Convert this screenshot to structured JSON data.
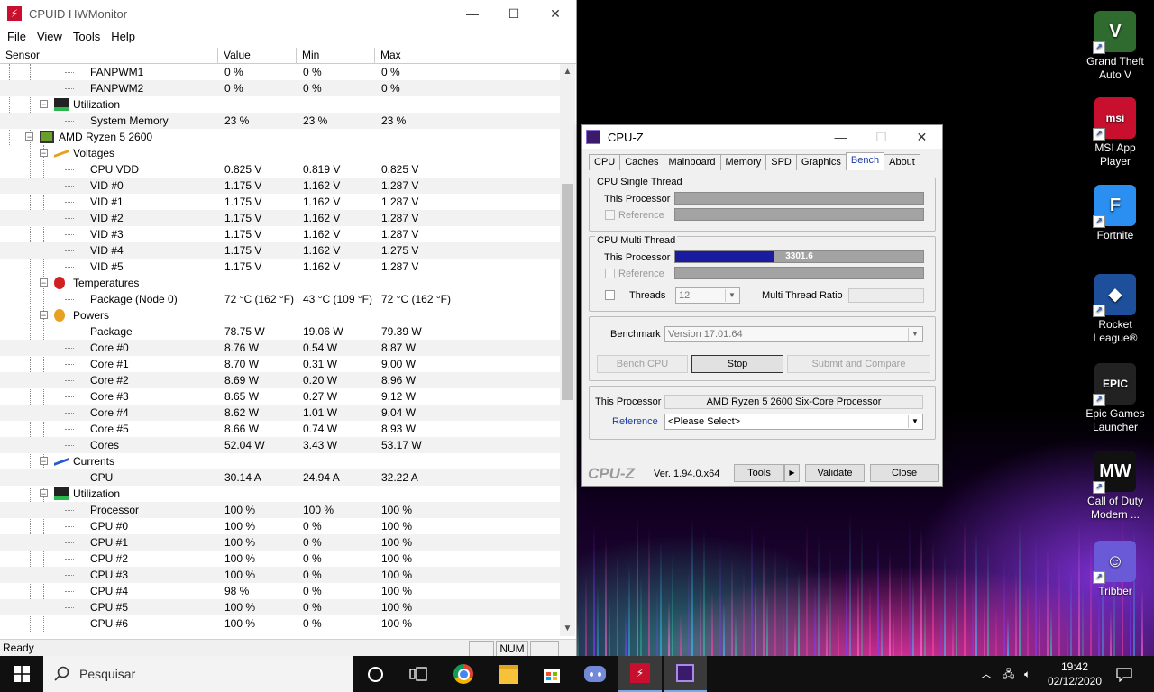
{
  "hwmonitor": {
    "title": "CPUID HWMonitor",
    "menu": [
      "File",
      "View",
      "Tools",
      "Help"
    ],
    "columns": [
      "Sensor",
      "Value",
      "Min",
      "Max"
    ],
    "status": "Ready",
    "status_num": "NUM",
    "rows": [
      {
        "type": "leaf",
        "name": "FANPWM1",
        "value": "0 %",
        "min": "0 %",
        "max": "0 %"
      },
      {
        "type": "leaf",
        "name": "FANPWM2",
        "value": "0 %",
        "min": "0 %",
        "max": "0 %"
      },
      {
        "type": "group",
        "name": "Utilization",
        "icon": "utilization-icon"
      },
      {
        "type": "leaf",
        "name": "System Memory",
        "value": "23 %",
        "min": "23 %",
        "max": "23 %"
      },
      {
        "type": "device",
        "name": "AMD Ryzen 5 2600",
        "icon": "cpu-chip-icon"
      },
      {
        "type": "group",
        "name": "Voltages",
        "icon": "voltage-icon"
      },
      {
        "type": "leaf",
        "name": "CPU VDD",
        "value": "0.825 V",
        "min": "0.819 V",
        "max": "0.825 V"
      },
      {
        "type": "leaf",
        "name": "VID #0",
        "value": "1.175 V",
        "min": "1.162 V",
        "max": "1.287 V"
      },
      {
        "type": "leaf",
        "name": "VID #1",
        "value": "1.175 V",
        "min": "1.162 V",
        "max": "1.287 V"
      },
      {
        "type": "leaf",
        "name": "VID #2",
        "value": "1.175 V",
        "min": "1.162 V",
        "max": "1.287 V"
      },
      {
        "type": "leaf",
        "name": "VID #3",
        "value": "1.175 V",
        "min": "1.162 V",
        "max": "1.287 V"
      },
      {
        "type": "leaf",
        "name": "VID #4",
        "value": "1.175 V",
        "min": "1.162 V",
        "max": "1.275 V"
      },
      {
        "type": "leaf",
        "name": "VID #5",
        "value": "1.175 V",
        "min": "1.162 V",
        "max": "1.287 V"
      },
      {
        "type": "group",
        "name": "Temperatures",
        "icon": "thermometer-icon"
      },
      {
        "type": "leaf",
        "name": "Package (Node 0)",
        "value": "72 °C  (162 °F)",
        "min": "43 °C  (109 °F)",
        "max": "72 °C  (162 °F)"
      },
      {
        "type": "group",
        "name": "Powers",
        "icon": "power-icon"
      },
      {
        "type": "leaf",
        "name": "Package",
        "value": "78.75 W",
        "min": "19.06 W",
        "max": "79.39 W"
      },
      {
        "type": "leaf",
        "name": "Core #0",
        "value": "8.76 W",
        "min": "0.54 W",
        "max": "8.87 W"
      },
      {
        "type": "leaf",
        "name": "Core #1",
        "value": "8.70 W",
        "min": "0.31 W",
        "max": "9.00 W"
      },
      {
        "type": "leaf",
        "name": "Core #2",
        "value": "8.69 W",
        "min": "0.20 W",
        "max": "8.96 W"
      },
      {
        "type": "leaf",
        "name": "Core #3",
        "value": "8.65 W",
        "min": "0.27 W",
        "max": "9.12 W"
      },
      {
        "type": "leaf",
        "name": "Core #4",
        "value": "8.62 W",
        "min": "1.01 W",
        "max": "9.04 W"
      },
      {
        "type": "leaf",
        "name": "Core #5",
        "value": "8.66 W",
        "min": "0.74 W",
        "max": "8.93 W"
      },
      {
        "type": "leaf",
        "name": "Cores",
        "value": "52.04 W",
        "min": "3.43 W",
        "max": "53.17 W"
      },
      {
        "type": "group",
        "name": "Currents",
        "icon": "current-icon"
      },
      {
        "type": "leaf",
        "name": "CPU",
        "value": "30.14 A",
        "min": "24.94 A",
        "max": "32.22 A"
      },
      {
        "type": "group",
        "name": "Utilization",
        "icon": "utilization-icon"
      },
      {
        "type": "leaf",
        "name": "Processor",
        "value": "100 %",
        "min": "100 %",
        "max": "100 %"
      },
      {
        "type": "leaf",
        "name": "CPU #0",
        "value": "100 %",
        "min": "0 %",
        "max": "100 %"
      },
      {
        "type": "leaf",
        "name": "CPU #1",
        "value": "100 %",
        "min": "0 %",
        "max": "100 %"
      },
      {
        "type": "leaf",
        "name": "CPU #2",
        "value": "100 %",
        "min": "0 %",
        "max": "100 %"
      },
      {
        "type": "leaf",
        "name": "CPU #3",
        "value": "100 %",
        "min": "0 %",
        "max": "100 %"
      },
      {
        "type": "leaf",
        "name": "CPU #4",
        "value": "98 %",
        "min": "0 %",
        "max": "100 %"
      },
      {
        "type": "leaf",
        "name": "CPU #5",
        "value": "100 %",
        "min": "0 %",
        "max": "100 %"
      },
      {
        "type": "leaf",
        "name": "CPU #6",
        "value": "100 %",
        "min": "0 %",
        "max": "100 %"
      }
    ]
  },
  "cpuz": {
    "title": "CPU-Z",
    "tabs": [
      "CPU",
      "Caches",
      "Mainboard",
      "Memory",
      "SPD",
      "Graphics",
      "Bench",
      "About"
    ],
    "active_tab": "Bench",
    "single_thread": {
      "label": "CPU Single Thread",
      "this_processor": "This Processor",
      "reference": "Reference"
    },
    "multi_thread": {
      "label": "CPU Multi Thread",
      "this_processor": "This Processor",
      "score": "3301.6",
      "progress": 0.4,
      "reference": "Reference",
      "threads_label": "Threads",
      "threads_value": "12",
      "ratio_label": "Multi Thread Ratio"
    },
    "benchmark_label": "Benchmark",
    "benchmark_version": "Version 17.01.64",
    "bench_cpu": "Bench CPU",
    "stop": "Stop",
    "submit_compare": "Submit and Compare",
    "this_processor_label": "This Processor",
    "this_processor_value": "AMD Ryzen 5 2600 Six-Core Processor",
    "reference_label": "Reference",
    "reference_value": "<Please Select>",
    "logo": "CPU-Z",
    "version": "Ver. 1.94.0.x64",
    "tools": "Tools",
    "validate": "Validate",
    "close": "Close"
  },
  "desktop_icons": [
    {
      "label": "Grand Theft Auto V",
      "icon": "gta-v-icon",
      "color": "#2f6a2f"
    },
    {
      "label": "MSI App Player",
      "icon": "msi-app-player-icon",
      "color": "#c8102e"
    },
    {
      "label": "Fortnite",
      "icon": "fortnite-icon",
      "color": "#2a8ff0"
    },
    {
      "label": "Rocket League®",
      "icon": "rocket-league-icon",
      "color": "#1d4f9a"
    },
    {
      "label": "Epic Games Launcher",
      "icon": "epic-games-icon",
      "color": "#222222"
    },
    {
      "label": "Call of Duty Modern ...",
      "icon": "call-of-duty-icon",
      "color": "#111111"
    },
    {
      "label": "Tribber",
      "icon": "tribber-icon",
      "color": "#6a5ad8"
    }
  ],
  "taskbar": {
    "search_placeholder": "Pesquisar",
    "time": "19:42",
    "date": "02/12/2020"
  }
}
